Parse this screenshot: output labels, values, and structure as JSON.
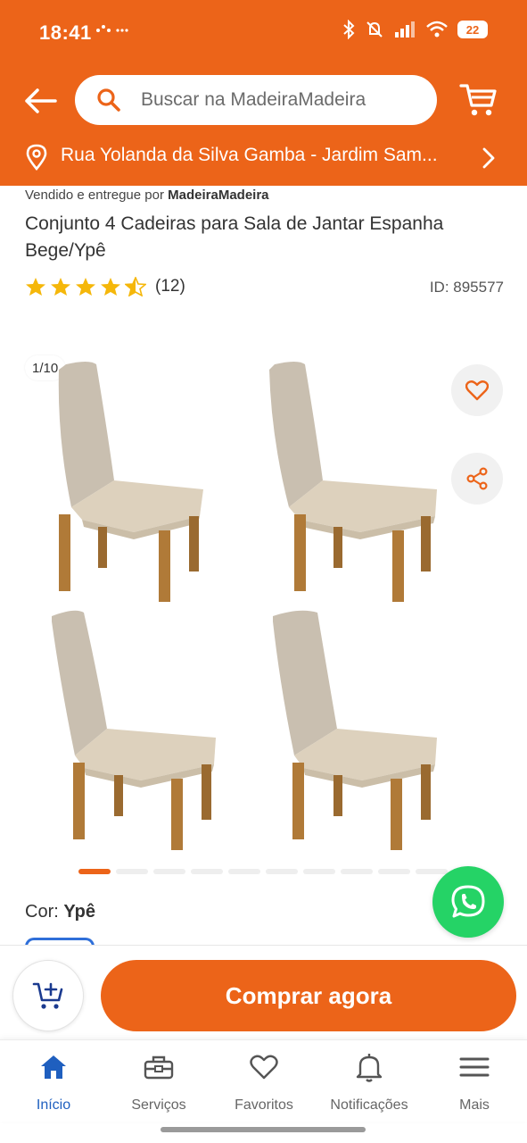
{
  "status_bar": {
    "time": "18:41",
    "battery": "22"
  },
  "search": {
    "placeholder": "Buscar na MadeiraMadeira"
  },
  "address": {
    "text": "Rua Yolanda da Silva Gamba - Jardim Sam..."
  },
  "product": {
    "seller_prefix": "Vendido e entregue por",
    "seller_name": "MadeiraMadeira",
    "title": "Conjunto 4 Cadeiras para Sala de Jantar Espanha Bege/Ypê",
    "rating": 4.5,
    "rating_count": "(12)",
    "id_text": "ID: 895577"
  },
  "gallery": {
    "counter": "1/10",
    "total_slides": 10,
    "active_slide": 1
  },
  "color": {
    "label": "Cor:",
    "value": "Ypê"
  },
  "actions": {
    "buy_label": "Comprar agora"
  },
  "nav": {
    "items": [
      {
        "label": "Início",
        "icon": "home-icon",
        "active": true
      },
      {
        "label": "Serviços",
        "icon": "toolbox-icon",
        "active": false
      },
      {
        "label": "Favoritos",
        "icon": "heart-icon",
        "active": false
      },
      {
        "label": "Notificações",
        "icon": "bell-icon",
        "active": false
      },
      {
        "label": "Mais",
        "icon": "menu-icon",
        "active": false
      }
    ]
  },
  "colors": {
    "brand": "#EC6419",
    "star": "#F5B70A",
    "whatsapp": "#25D366",
    "nav_active": "#1f5fbf"
  }
}
